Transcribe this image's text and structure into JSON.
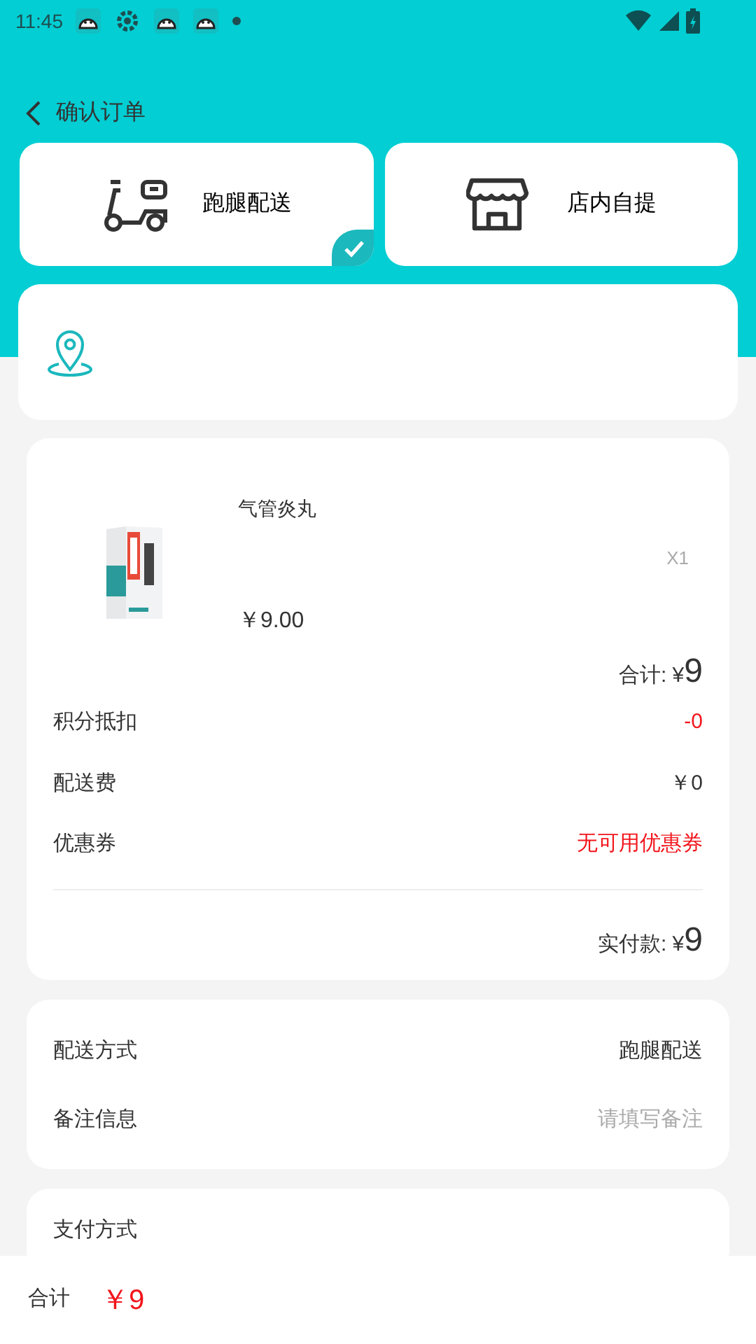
{
  "status_bar": {
    "time": "11:45"
  },
  "header": {
    "title": "确认订单"
  },
  "delivery_options": [
    {
      "label": "跑腿配送",
      "kind": "scooter",
      "selected": true
    },
    {
      "label": "店内自提",
      "kind": "store",
      "selected": false
    }
  ],
  "address": {
    "kind": "empty"
  },
  "product": {
    "name": "气管炎丸",
    "price": "￥9.00",
    "quantity": "X1"
  },
  "subtotal": {
    "label": "合计:",
    "currency": "¥",
    "amount": "9"
  },
  "summary_rows": [
    {
      "label": "积分抵扣",
      "value": "-0",
      "kind": "alert"
    },
    {
      "label": "配送费",
      "value": "￥0",
      "kind": "plain"
    },
    {
      "label": "优惠券",
      "value": "无可用优惠券",
      "kind": "alert"
    }
  ],
  "paid": {
    "label": "实付款:",
    "currency": "¥",
    "amount": "9"
  },
  "order_info": [
    {
      "label": "配送方式",
      "value": "跑腿配送",
      "kind": "value"
    },
    {
      "label": "备注信息",
      "placeholder": "请填写备注",
      "kind": "input"
    }
  ],
  "payment": {
    "label": "支付方式"
  },
  "bottom_bar": {
    "label": "合计",
    "total": "￥9"
  }
}
